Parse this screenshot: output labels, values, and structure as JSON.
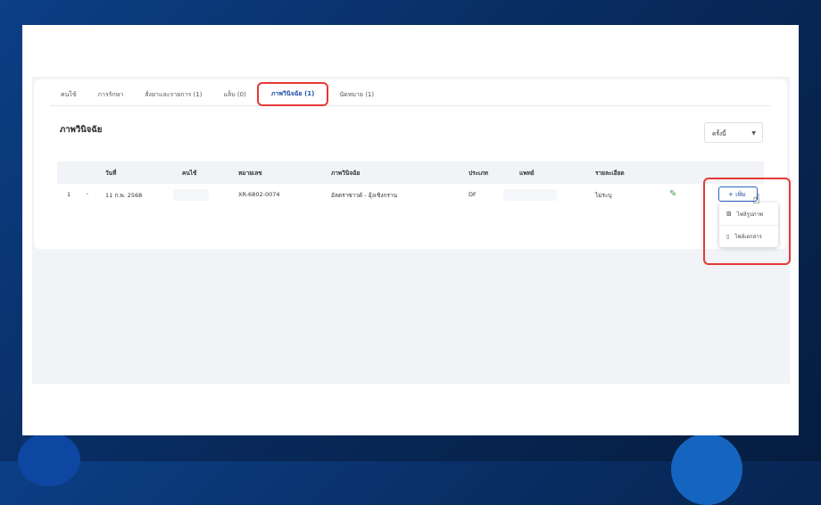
{
  "tabs": [
    {
      "label": "คนไข้"
    },
    {
      "label": "การรักษา"
    },
    {
      "label": "สั่งยาและรายการ (1)"
    },
    {
      "label": "แล็บ (0)"
    },
    {
      "label": "ภาพวินิจฉัย (1)"
    },
    {
      "label": "นัดหมาย (1)"
    }
  ],
  "active_tab": "ภาพวินิจฉัย (1)",
  "section_title": "ภาพวินิจฉัย",
  "filter_select": {
    "value": "ครั้งนี้"
  },
  "table": {
    "headers": [
      "วันที่",
      "คนไข้",
      "หมายเลข",
      "ภาพวินิจฉัย",
      "ประเภท",
      "แพทย์",
      "รายละเอียด"
    ],
    "rows": [
      {
        "index": "1",
        "date": "11 ก.พ. 2568",
        "number": "XR-6802-0074",
        "imaging": "อัลตราซาวด์ - อุ้งเชิงกราน",
        "type": "DF",
        "detail": "ไม่ระบุ"
      }
    ]
  },
  "add_button": {
    "label": "เพิ่ม"
  },
  "add_menu": [
    {
      "label": "ไฟล์รูปภาพ",
      "icon": "image-icon"
    },
    {
      "label": "ไฟล์เอกสาร",
      "icon": "document-icon"
    }
  ],
  "colors": {
    "accent": "#1f4fa8",
    "highlight": "#e53935",
    "edit": "#3aa34a"
  }
}
